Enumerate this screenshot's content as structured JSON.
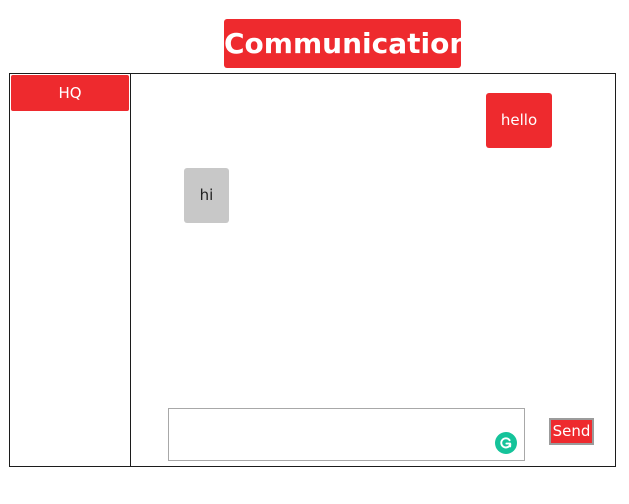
{
  "header": {
    "title": "Communication"
  },
  "sidebar": {
    "contacts": [
      {
        "label": "HQ"
      }
    ]
  },
  "chat": {
    "messages": [
      {
        "text": "hello",
        "direction": "sent"
      },
      {
        "text": "hi",
        "direction": "received"
      }
    ]
  },
  "composer": {
    "value": "",
    "send_label": "Send",
    "grammar_icon": "grammarly-icon"
  },
  "colors": {
    "accent": "#ee2a2e",
    "received_bubble": "#c8c8c8",
    "grammar_badge": "#15c39a"
  }
}
